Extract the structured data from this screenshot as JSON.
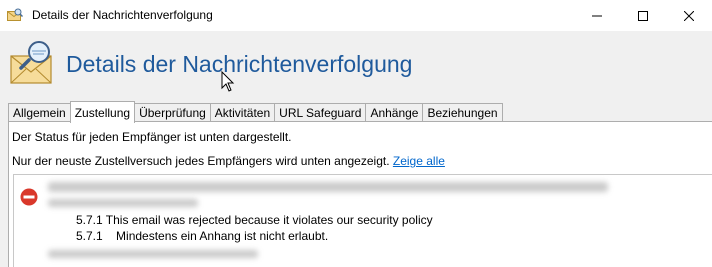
{
  "window": {
    "title": "Details der Nachrichtenverfolgung"
  },
  "header": {
    "title": "Details der Nachrichtenverfolgung"
  },
  "tabs": [
    {
      "label": "Allgemein",
      "active": false
    },
    {
      "label": "Zustellung",
      "active": true
    },
    {
      "label": "Überprüfung",
      "active": false
    },
    {
      "label": "Aktivitäten",
      "active": false
    },
    {
      "label": "URL Safeguard",
      "active": false
    },
    {
      "label": "Anhänge",
      "active": false
    },
    {
      "label": "Beziehungen",
      "active": false
    }
  ],
  "content": {
    "status_text": "Der Status für jeden Empfänger ist unten dargestellt.",
    "latest_text": "Nur der neuste Zustellversuch jedes Empfängers wird unten angezeigt.",
    "show_all_link": "Zeige alle",
    "messages": [
      "5.7.1 This email was rejected because it violates our security policy",
      "5.7.1    Mindestens ein Anhang ist nicht erlaubt."
    ]
  },
  "colors": {
    "title_blue": "#1f5a9c",
    "link_blue": "#0066cc",
    "error_red": "#d9382b"
  }
}
